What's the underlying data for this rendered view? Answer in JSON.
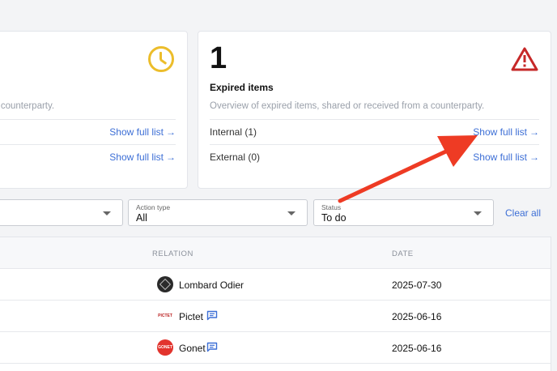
{
  "left_card": {
    "description": "our counterparty.",
    "rows": [
      {
        "link": "Show full list"
      },
      {
        "link": "Show full list"
      }
    ]
  },
  "right_card": {
    "count": "1",
    "title": "Expired items",
    "description": "Overview of expired items, shared or received from a counterparty.",
    "rows": [
      {
        "label": "Internal (1)",
        "link": "Show full list"
      },
      {
        "label": "External (0)",
        "link": "Show full list"
      }
    ]
  },
  "filters": {
    "action_type": {
      "label": "Action type",
      "value": "All"
    },
    "status": {
      "label": "Status",
      "value": "To do"
    },
    "clear_all": "Clear all"
  },
  "table": {
    "columns": [
      "RELATION",
      "DATE"
    ],
    "rows": [
      {
        "relation": "Lombard Odier",
        "avatar_text": "",
        "date": "2025-07-30",
        "has_chat": false
      },
      {
        "relation": "Pictet",
        "avatar_text": "PICTET",
        "date": "2025-06-16",
        "has_chat": true
      },
      {
        "relation": "Gonet",
        "avatar_text": "GONET",
        "date": "2025-06-16",
        "has_chat": true
      }
    ]
  },
  "colors": {
    "link": "#3d6fd6",
    "clock": "#ecbd2b",
    "warning": "#c62828",
    "annotation_arrow": "#ee3b24"
  },
  "icons": {
    "clock": "clock-icon",
    "warning": "warning-triangle-icon",
    "chat": "chat-bubble-icon",
    "arrow": "arrow-right-icon"
  }
}
